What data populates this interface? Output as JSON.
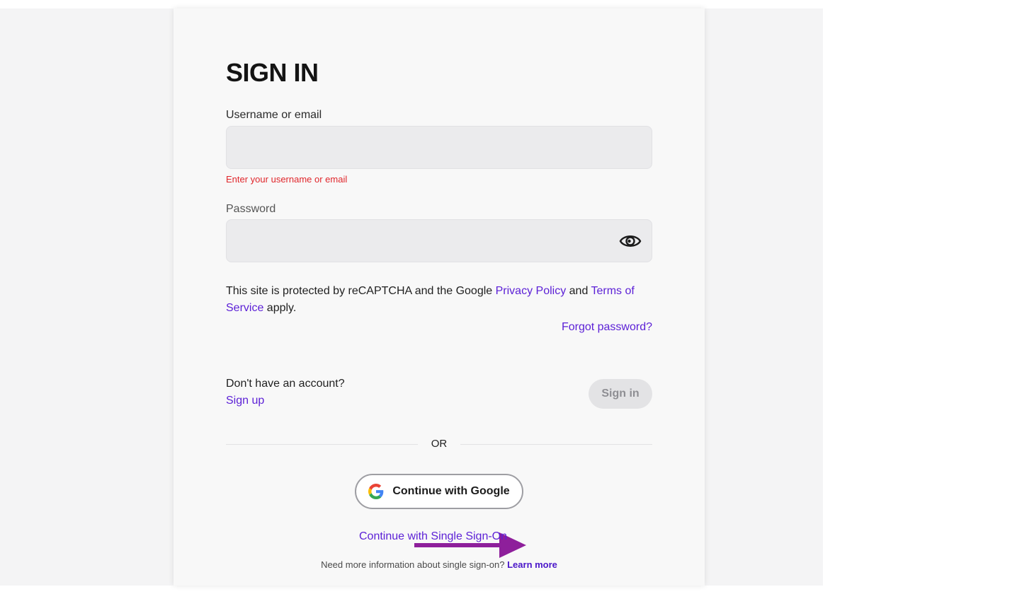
{
  "title": "SIGN IN",
  "username": {
    "label": "Username or email",
    "value": "",
    "error": "Enter your username or email"
  },
  "password": {
    "label": "Password",
    "value": "",
    "toggle_icon": "eye-icon"
  },
  "legal": {
    "prefix": "This site is protected by reCAPTCHA and the Google ",
    "privacy_link": "Privacy Policy",
    "middle": " and ",
    "terms_link": "Terms of Service",
    "suffix": " apply."
  },
  "forgot_password": "Forgot password?",
  "signup": {
    "prompt": "Don't have an account?",
    "link": "Sign up"
  },
  "signin_button": "Sign in",
  "divider_text": "OR",
  "google_button": "Continue with Google",
  "sso": {
    "link": "Continue with Single Sign-On",
    "help_prefix": "Need more information about single sign-on? ",
    "help_link": "Learn more"
  },
  "colors": {
    "link": "#5b1fd6",
    "error": "#e0262b",
    "arrow": "#8e1f9b"
  }
}
